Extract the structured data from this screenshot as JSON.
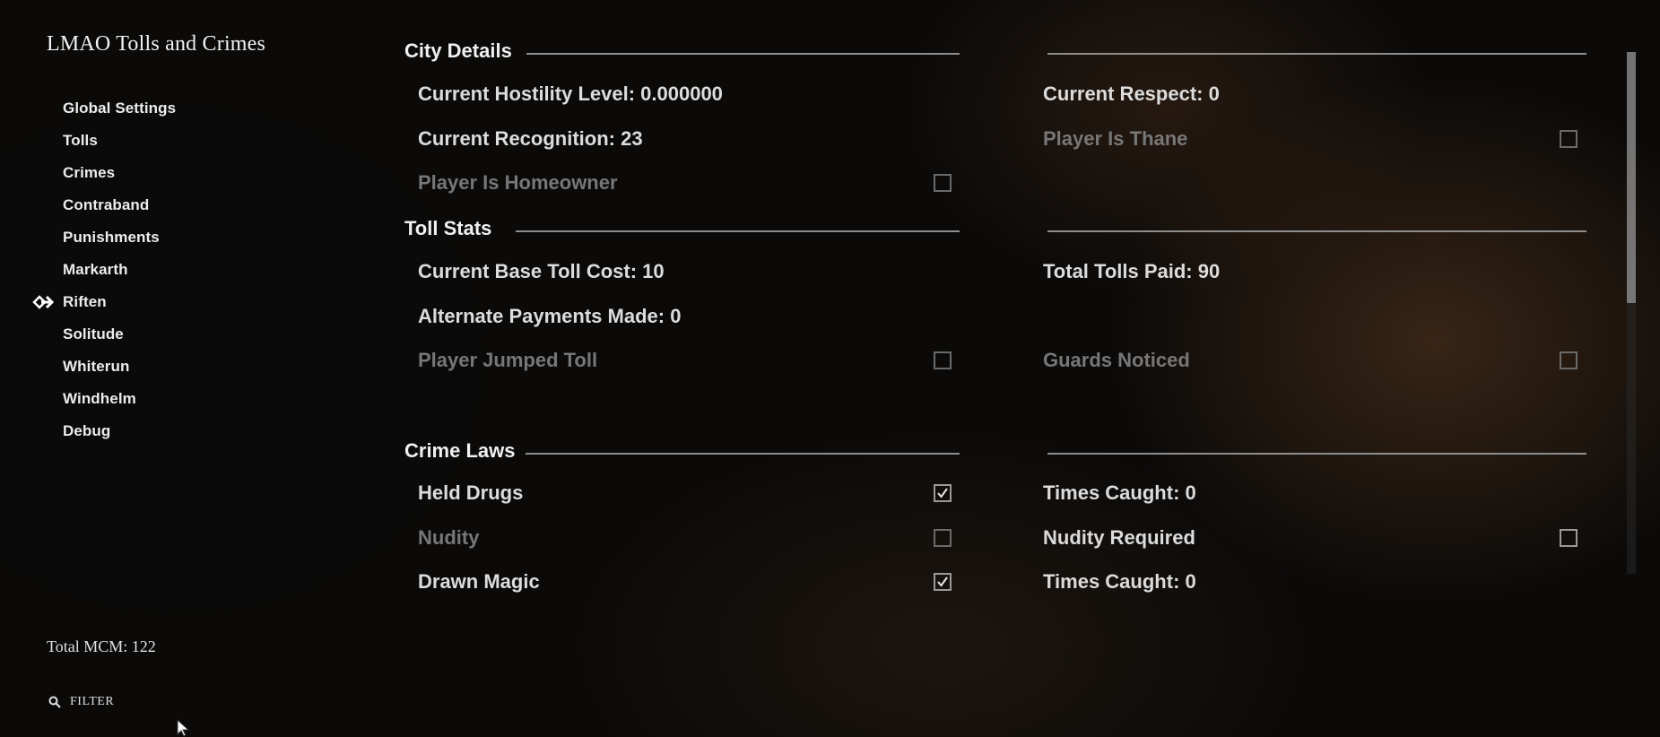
{
  "title": "LMAO Tolls and Crimes",
  "sidebar": {
    "items": [
      {
        "label": "Global Settings"
      },
      {
        "label": "Tolls"
      },
      {
        "label": "Crimes"
      },
      {
        "label": "Contraband"
      },
      {
        "label": "Punishments"
      },
      {
        "label": "Markarth"
      },
      {
        "label": "Riften",
        "selected": true
      },
      {
        "label": "Solitude"
      },
      {
        "label": "Whiterun"
      },
      {
        "label": "Windhelm"
      },
      {
        "label": "Debug"
      }
    ]
  },
  "footer": {
    "total_mcm": "Total MCM: 122",
    "filter_placeholder": "FILTER"
  },
  "sections": {
    "city": {
      "title": "City Details",
      "hostility": "Current Hostility Level: 0.000000",
      "respect": "Current Respect: 0",
      "recognition": "Current Recognition: 23",
      "thane": {
        "label": "Player Is Thane",
        "checked": false,
        "disabled": true
      },
      "homeowner": {
        "label": "Player Is Homeowner",
        "checked": false,
        "disabled": true
      }
    },
    "toll": {
      "title": "Toll Stats",
      "base_cost": "Current Base Toll Cost: 10",
      "total_paid": "Total Tolls Paid: 90",
      "alternate": "Alternate Payments Made: 0",
      "jumped": {
        "label": "Player Jumped Toll",
        "checked": false,
        "disabled": true
      },
      "guards": {
        "label": "Guards Noticed",
        "checked": false,
        "disabled": true
      }
    },
    "crime": {
      "title": "Crime Laws",
      "held_drugs": {
        "label": "Held Drugs",
        "checked": true,
        "disabled": false
      },
      "times_caught_1": "Times Caught: 0",
      "nudity": {
        "label": "Nudity",
        "checked": false,
        "disabled": true
      },
      "nudity_required": {
        "label": "Nudity Required",
        "checked": false,
        "disabled": false
      },
      "drawn_magic": {
        "label": "Drawn Magic",
        "checked": true,
        "disabled": false
      },
      "times_caught_2": "Times Caught: 0"
    }
  },
  "colors": {
    "accent": "#f0f0f0",
    "disabled": "#777777",
    "rule": "#8e8e8e"
  }
}
